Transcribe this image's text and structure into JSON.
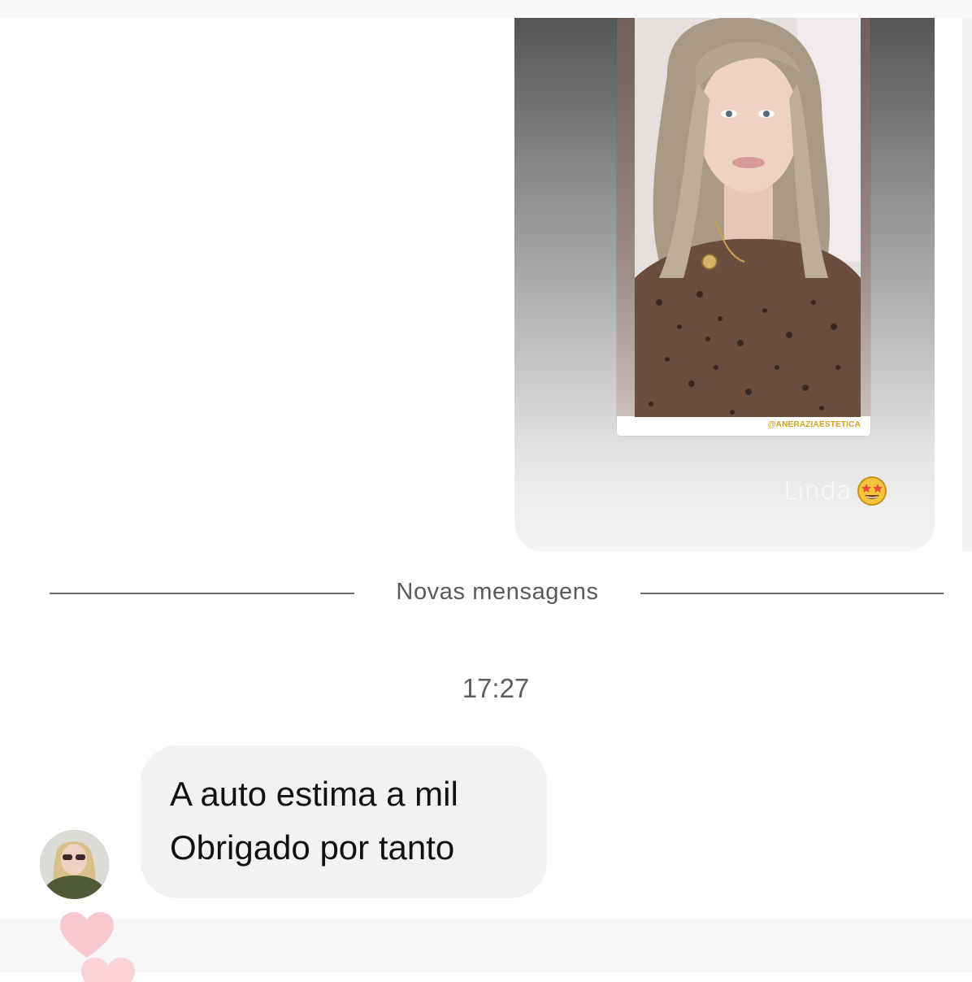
{
  "story_reply": {
    "handle": "@ANERAZIAESTETICA",
    "caption": "Linda",
    "emoji": "star-struck-emoji"
  },
  "divider": {
    "label": "Novas mensagens"
  },
  "timestamp": "17:27",
  "message": {
    "line1": "A auto estima a mil",
    "line2": "Obrigado por tanto"
  },
  "reactions": [
    "heart-icon",
    "heart-icon"
  ],
  "colors": {
    "bubble": "#f1f2f4",
    "divider": "#6e6e6e",
    "handle": "#d6a21d",
    "heart": "#f7c8cc"
  }
}
